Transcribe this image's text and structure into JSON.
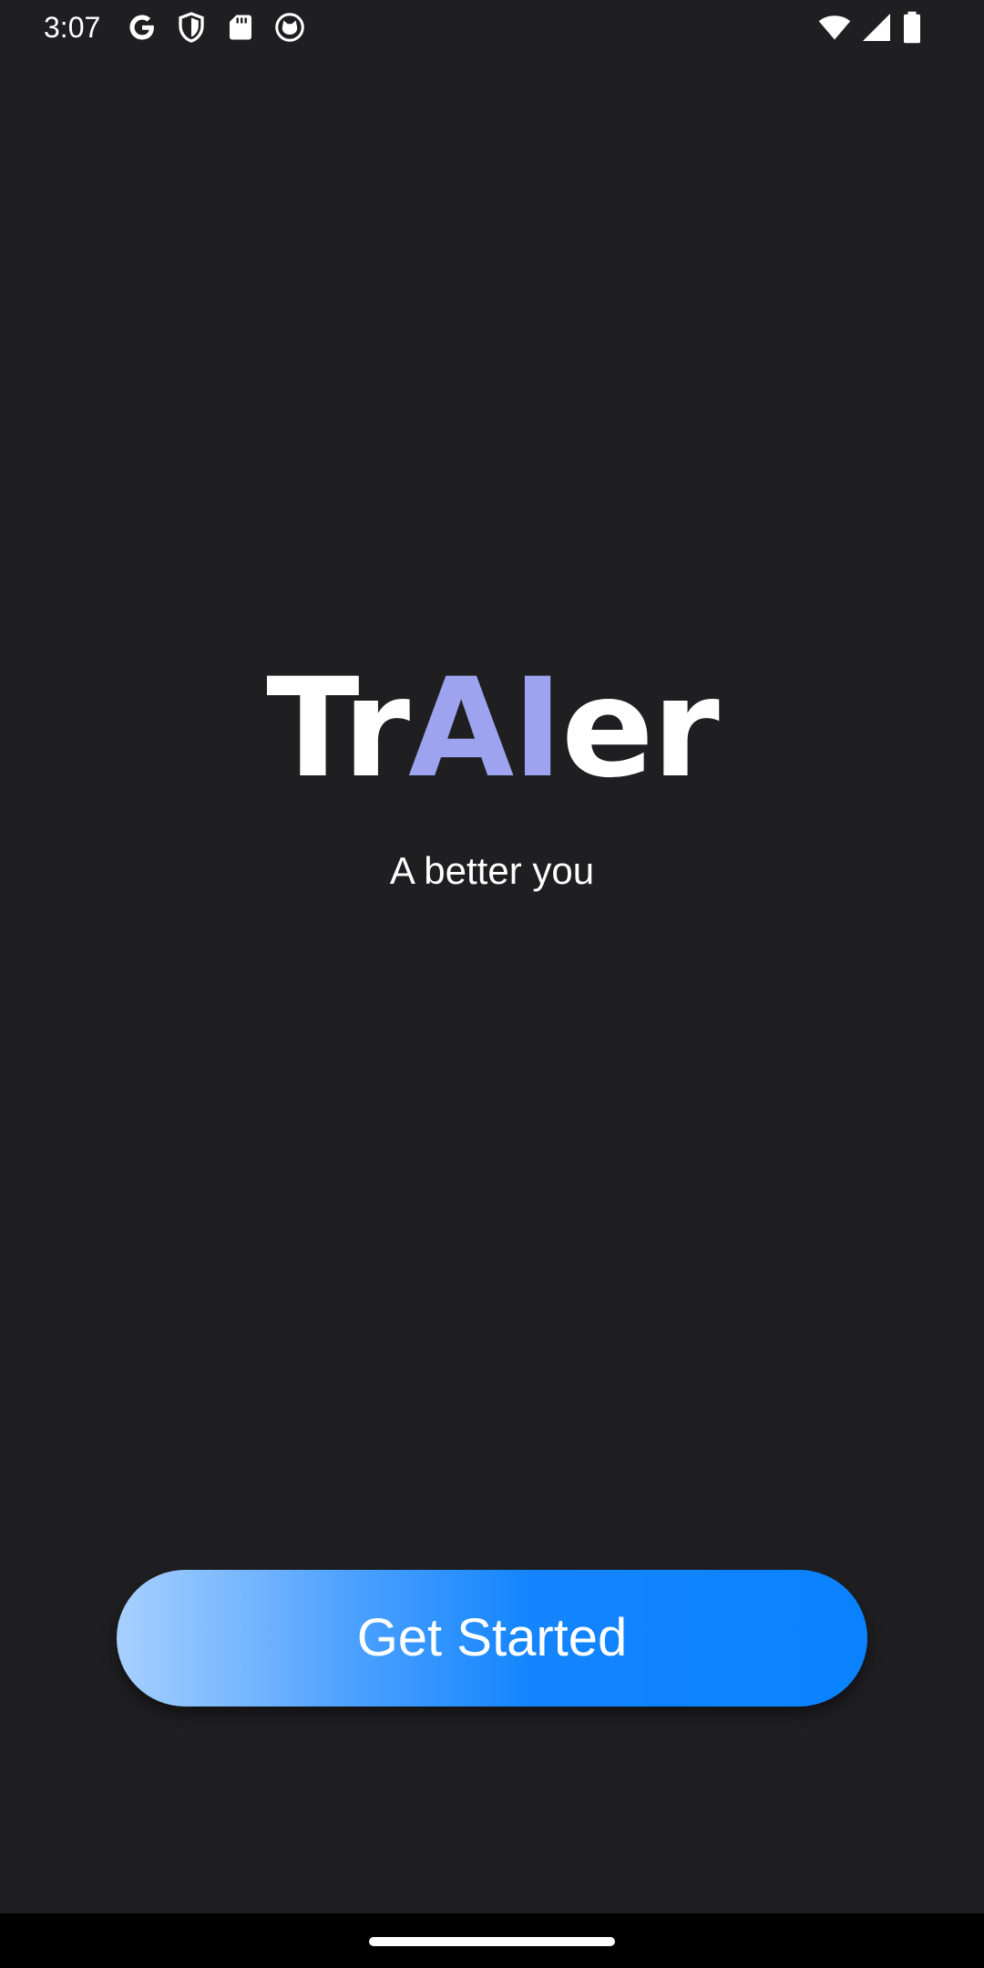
{
  "status_bar": {
    "time": "3:07",
    "left_icons": [
      "google-icon",
      "shield-icon",
      "sd-card-icon",
      "cat-face-icon"
    ],
    "right_icons": [
      "wifi-icon",
      "cell-signal-icon",
      "battery-icon"
    ]
  },
  "logo": {
    "part1": "Tr",
    "part2": "AI",
    "part3": "er",
    "accent_color": "#9da3ee"
  },
  "tagline": "A better you",
  "cta": {
    "label": "Get Started",
    "gradient_start": "#a8d0ff",
    "gradient_end": "#0a82ff"
  },
  "colors": {
    "background": "#1f1f22"
  }
}
